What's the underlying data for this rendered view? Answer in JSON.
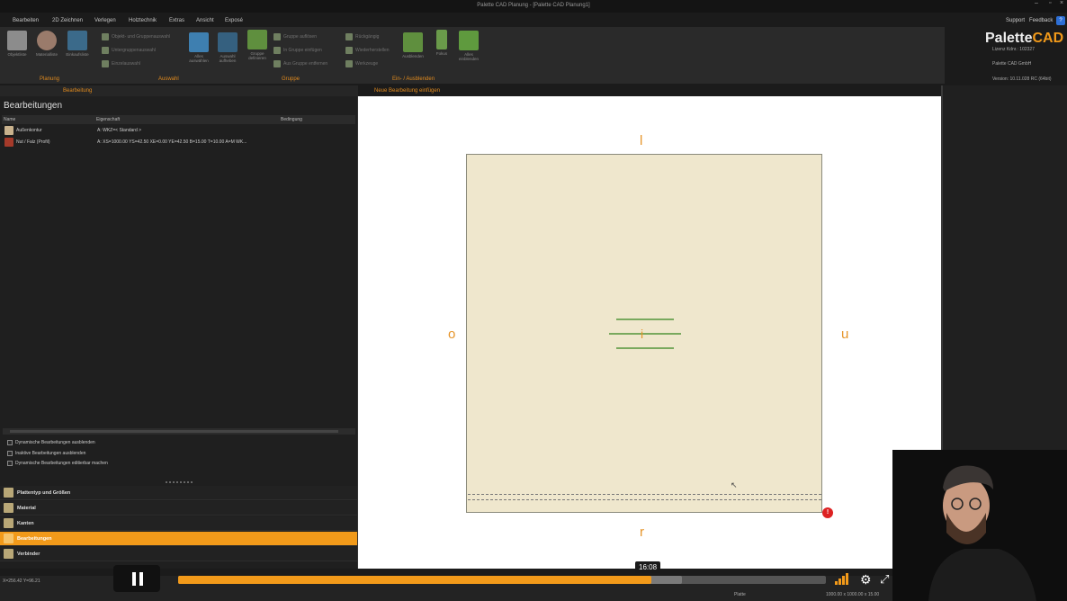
{
  "window": {
    "title": "Palette CAD Planung - [Palette CAD Planung1]"
  },
  "menu": [
    "Bearbeiten",
    "2D Zeichnen",
    "Verlegen",
    "Holztechnik",
    "Extras",
    "Ansicht",
    "Exposé"
  ],
  "menu_right": {
    "support": "Support",
    "feedback": "Feedback",
    "help": "?"
  },
  "ribbon": {
    "big_buttons": [
      {
        "label": "Objektliste",
        "icon": "object-list-icon"
      },
      {
        "label": "Materialliste",
        "icon": "material-list-icon"
      },
      {
        "label": "Einkaufsliste",
        "icon": "shopping-cart-icon"
      },
      {
        "label": "Alles auswählen",
        "icon": "select-all-icon"
      },
      {
        "label": "Auswahl aufheben",
        "icon": "deselect-icon"
      },
      {
        "label": "Gruppe definieren",
        "icon": "group-define-icon"
      },
      {
        "label": "Ausblenden",
        "icon": "hide-icon"
      },
      {
        "label": "Fokus",
        "icon": "focus-icon"
      },
      {
        "label": "Alles einblenden",
        "icon": "show-all-icon"
      }
    ],
    "small_buttons": [
      {
        "label": "Objekt- und Gruppenauswahl"
      },
      {
        "label": "Untergruppenauswahl"
      },
      {
        "label": "Einzelauswahl"
      },
      {
        "label": "Gruppe auflösen"
      },
      {
        "label": "In Gruppe einfügen"
      },
      {
        "label": "Aus Gruppe entfernen"
      },
      {
        "label": "Rückgängig"
      },
      {
        "label": "Wiederherstellen"
      },
      {
        "label": "Werkzeuge"
      }
    ],
    "groups": [
      "Planung",
      "Auswahl",
      "Gruppe",
      "Ein- / Ausblenden"
    ]
  },
  "brand": {
    "name_a": "Palette",
    "name_b": "CAD",
    "license": "Lizenz Kdnr.: 102327",
    "company": "Palette CAD GmbH",
    "version": "Version: 10.11.028 RC (64bit)"
  },
  "panel": {
    "tab": "Bearbeitung",
    "title": "Bearbeitungen",
    "columns": [
      "Name",
      "Eigenschaft",
      "Bedingung"
    ],
    "rows": [
      {
        "name": "Außenkontur",
        "prop": "A: WKZ=< Standard >",
        "cond": ""
      },
      {
        "name": "Nut / Falz (Profil)",
        "prop": "A: XS=1000.00  YS=42.50  XE=0.00  YE=42.50  B=15.00  T=10.00  A=M  WK...",
        "cond": ""
      }
    ],
    "checkboxes": [
      "Dynamische Bearbeitungen ausblenden",
      "Inaktive Bearbeitungen ausblenden",
      "Dynamische Bearbeitungen editierbar machen"
    ],
    "nav": [
      "Plattentyp und Größen",
      "Material",
      "Kanten",
      "Bearbeitungen",
      "Verbinder"
    ],
    "nav_active": 3
  },
  "canvas": {
    "tab": "Neue Bearbeitung einfügen",
    "labels": {
      "top": "l",
      "left": "o",
      "right": "u",
      "bottom": "r",
      "center": "i"
    },
    "warn": "!"
  },
  "status": {
    "coords": "X=256.42  Y=96.21",
    "plate": "Platte",
    "dims": "1000.00 x 1000.00 x 15.00"
  },
  "player": {
    "time": "16:08",
    "progress": 0.73
  }
}
